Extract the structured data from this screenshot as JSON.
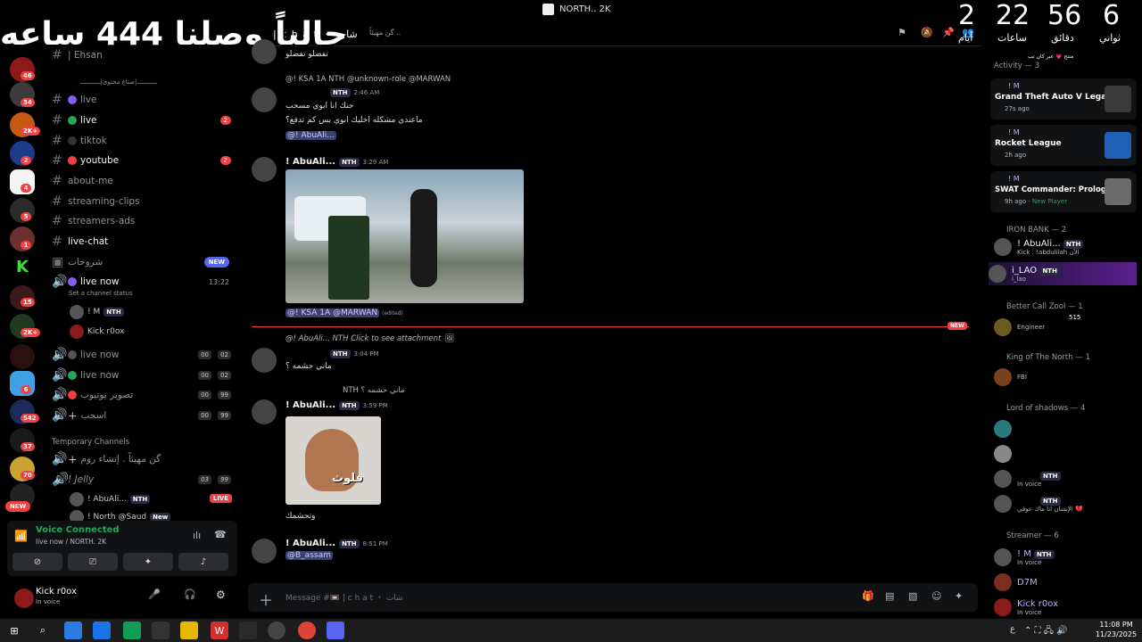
{
  "window": {
    "title": "NORTH.. 2K"
  },
  "overlay": {
    "arabic_text": "حالياً وصلنا 444 ساعه"
  },
  "timer": {
    "digits": [
      "2",
      "22",
      "56",
      "6"
    ],
    "labels": [
      "ساعات",
      "دقائق",
      "ثواني"
    ],
    "extra_label": "أيام"
  },
  "guilds": {
    "badges": [
      "46",
      "34",
      "2K+",
      "2",
      "4",
      "5",
      "1",
      "2K+",
      "15",
      "6",
      "542",
      "37",
      "70"
    ],
    "new_label": "NEW"
  },
  "sidebar": {
    "server_name": "NORTH. 2K",
    "ehsan": "| Ehsan",
    "category": "ـــــــــــ|صناع محتوى|ـــــــــــ",
    "channels": [
      {
        "name": "live",
        "badge": ""
      },
      {
        "name": "live",
        "badge": "2"
      },
      {
        "name": "tiktok",
        "badge": ""
      },
      {
        "name": "youtube",
        "badge": "2"
      },
      {
        "name": "about-me",
        "badge": ""
      },
      {
        "name": "streaming-clips",
        "badge": ""
      },
      {
        "name": "streamers-ads",
        "badge": ""
      },
      {
        "name": "live-chat",
        "badge": ""
      },
      {
        "name": "شروحات",
        "badge": "NEW"
      }
    ],
    "voice_live_now": {
      "name": "live now",
      "time": "13:22",
      "status": "Set a channel status"
    },
    "voice_users": [
      {
        "name": "! M",
        "tag": "NTH"
      },
      {
        "name": "Kick r0ox",
        "tag": ""
      }
    ],
    "voice_channels": [
      {
        "name": "live now",
        "count": "00",
        "limit": "02"
      },
      {
        "name": "live now",
        "count": "00",
        "limit": "02"
      },
      {
        "name": "تصوير يوتيوب",
        "count": "00",
        "limit": "99"
      },
      {
        "name": "اسحب",
        "count": "00",
        "limit": "99"
      }
    ],
    "temp_category": "Temporary Channels",
    "temp_create": "گن مهيئاً . إنشاء روم",
    "jelly": {
      "name": "! Jelly",
      "count": "03",
      "limit": "99"
    },
    "jelly_users": [
      {
        "name": "! AbuAli...",
        "tag": "NTH",
        "live": "LIVE"
      },
      {
        "name": "! North @Saud",
        "tag": "New"
      }
    ]
  },
  "voice_panel": {
    "title": "Voice Connected",
    "sub": "live now / NORTH. 2K"
  },
  "user_panel": {
    "name": "Kick r0ox",
    "status": "In voice"
  },
  "chat_header": {
    "channel": "| c h a t ・ شات",
    "topic": "گن مهيئاً .."
  },
  "messages": {
    "m0": {
      "text": "تفضلو تفضلو"
    },
    "m1": {
      "reply": "@! KSA 1A  NTH  @unknown-role  @MARWAN",
      "name_tag": "NTH",
      "time": "2:46 AM",
      "lines": [
        "حنك انا ابوي مسحب",
        "ماعندي مشكله اخليك ابوي بس كم تدفع؟"
      ],
      "mention": "@! AbuAli..."
    },
    "m2": {
      "name": "! AbuAli...",
      "tag": "NTH",
      "time": "3:29 AM",
      "mentions": "@! KSA 1A  @MARWAN",
      "edited": "(edited)"
    },
    "m3": {
      "reply": "@! AbuAli...  NTH  Click to see attachment",
      "tag": "NTH",
      "time": "3:04 PM",
      "text": "ماني حشمه ؟",
      "new_label": "NEW"
    },
    "m4": {
      "reply": "NTH  ماني حشمه ؟",
      "name": "! AbuAli...",
      "tag": "NTH",
      "time": "3:59 PM",
      "caption": "فلوث",
      "text": "وتحشمك"
    },
    "m5": {
      "name": "! AbuAli...",
      "tag": "NTH",
      "time": "8:51 PM",
      "mention": "@B_assam"
    }
  },
  "composer": {
    "placeholder": "Message #📼 | c h a t ・ شات"
  },
  "members": {
    "activity_header": "Activity — 3",
    "top_note": "متنح 💗 عبر كان تب",
    "cards": [
      {
        "user": "! M",
        "game": "Grand Theft Auto V Legacy",
        "time": "27s ago",
        "color": "#3a3a3a"
      },
      {
        "user": "! M",
        "game": "Rocket League",
        "time": "2h ago",
        "color": "#1f5fb5"
      },
      {
        "user": "! M",
        "game": "SWAT Commander: Prologue",
        "time": "9h ago",
        "extra": "New Player",
        "color": "#6a6a6a"
      }
    ],
    "groups": [
      {
        "name": "IRON BANK — 2"
      },
      {
        "name": "Better Call Zool — 1"
      },
      {
        "name": "King of The North — 1"
      },
      {
        "name": "Lord of shadows — 4"
      },
      {
        "name": "Streamer — 6"
      }
    ],
    "iron": [
      {
        "name": "! AbuAli...",
        "tag": "NTH",
        "sub": "Kick : !abdulilah  الآن"
      },
      {
        "name": "i_LAO",
        "tag": "NTH",
        "sub": "i_lao"
      }
    ],
    "zool": {
      "sub": "Engineer",
      "boost": "515"
    },
    "north": {
      "sub": "FBI"
    },
    "shadows": [
      {
        "name": "",
        "sub": ""
      },
      {
        "name": "",
        "sub": ""
      },
      {
        "name": "NTH",
        "sub": "In voice"
      },
      {
        "name": "NTH",
        "sub": "الإنسان انا ماك عوقي 💔"
      }
    ],
    "streamers": [
      {
        "name": "! M",
        "tag": "NTH",
        "sub": "In voice"
      },
      {
        "name": "D7M",
        "sub": ""
      },
      {
        "name": "Kick r0ox",
        "sub": "In voice"
      }
    ]
  },
  "taskbar": {
    "time": "11:08 PM",
    "date": "11/23/2025",
    "lang": "ع"
  }
}
